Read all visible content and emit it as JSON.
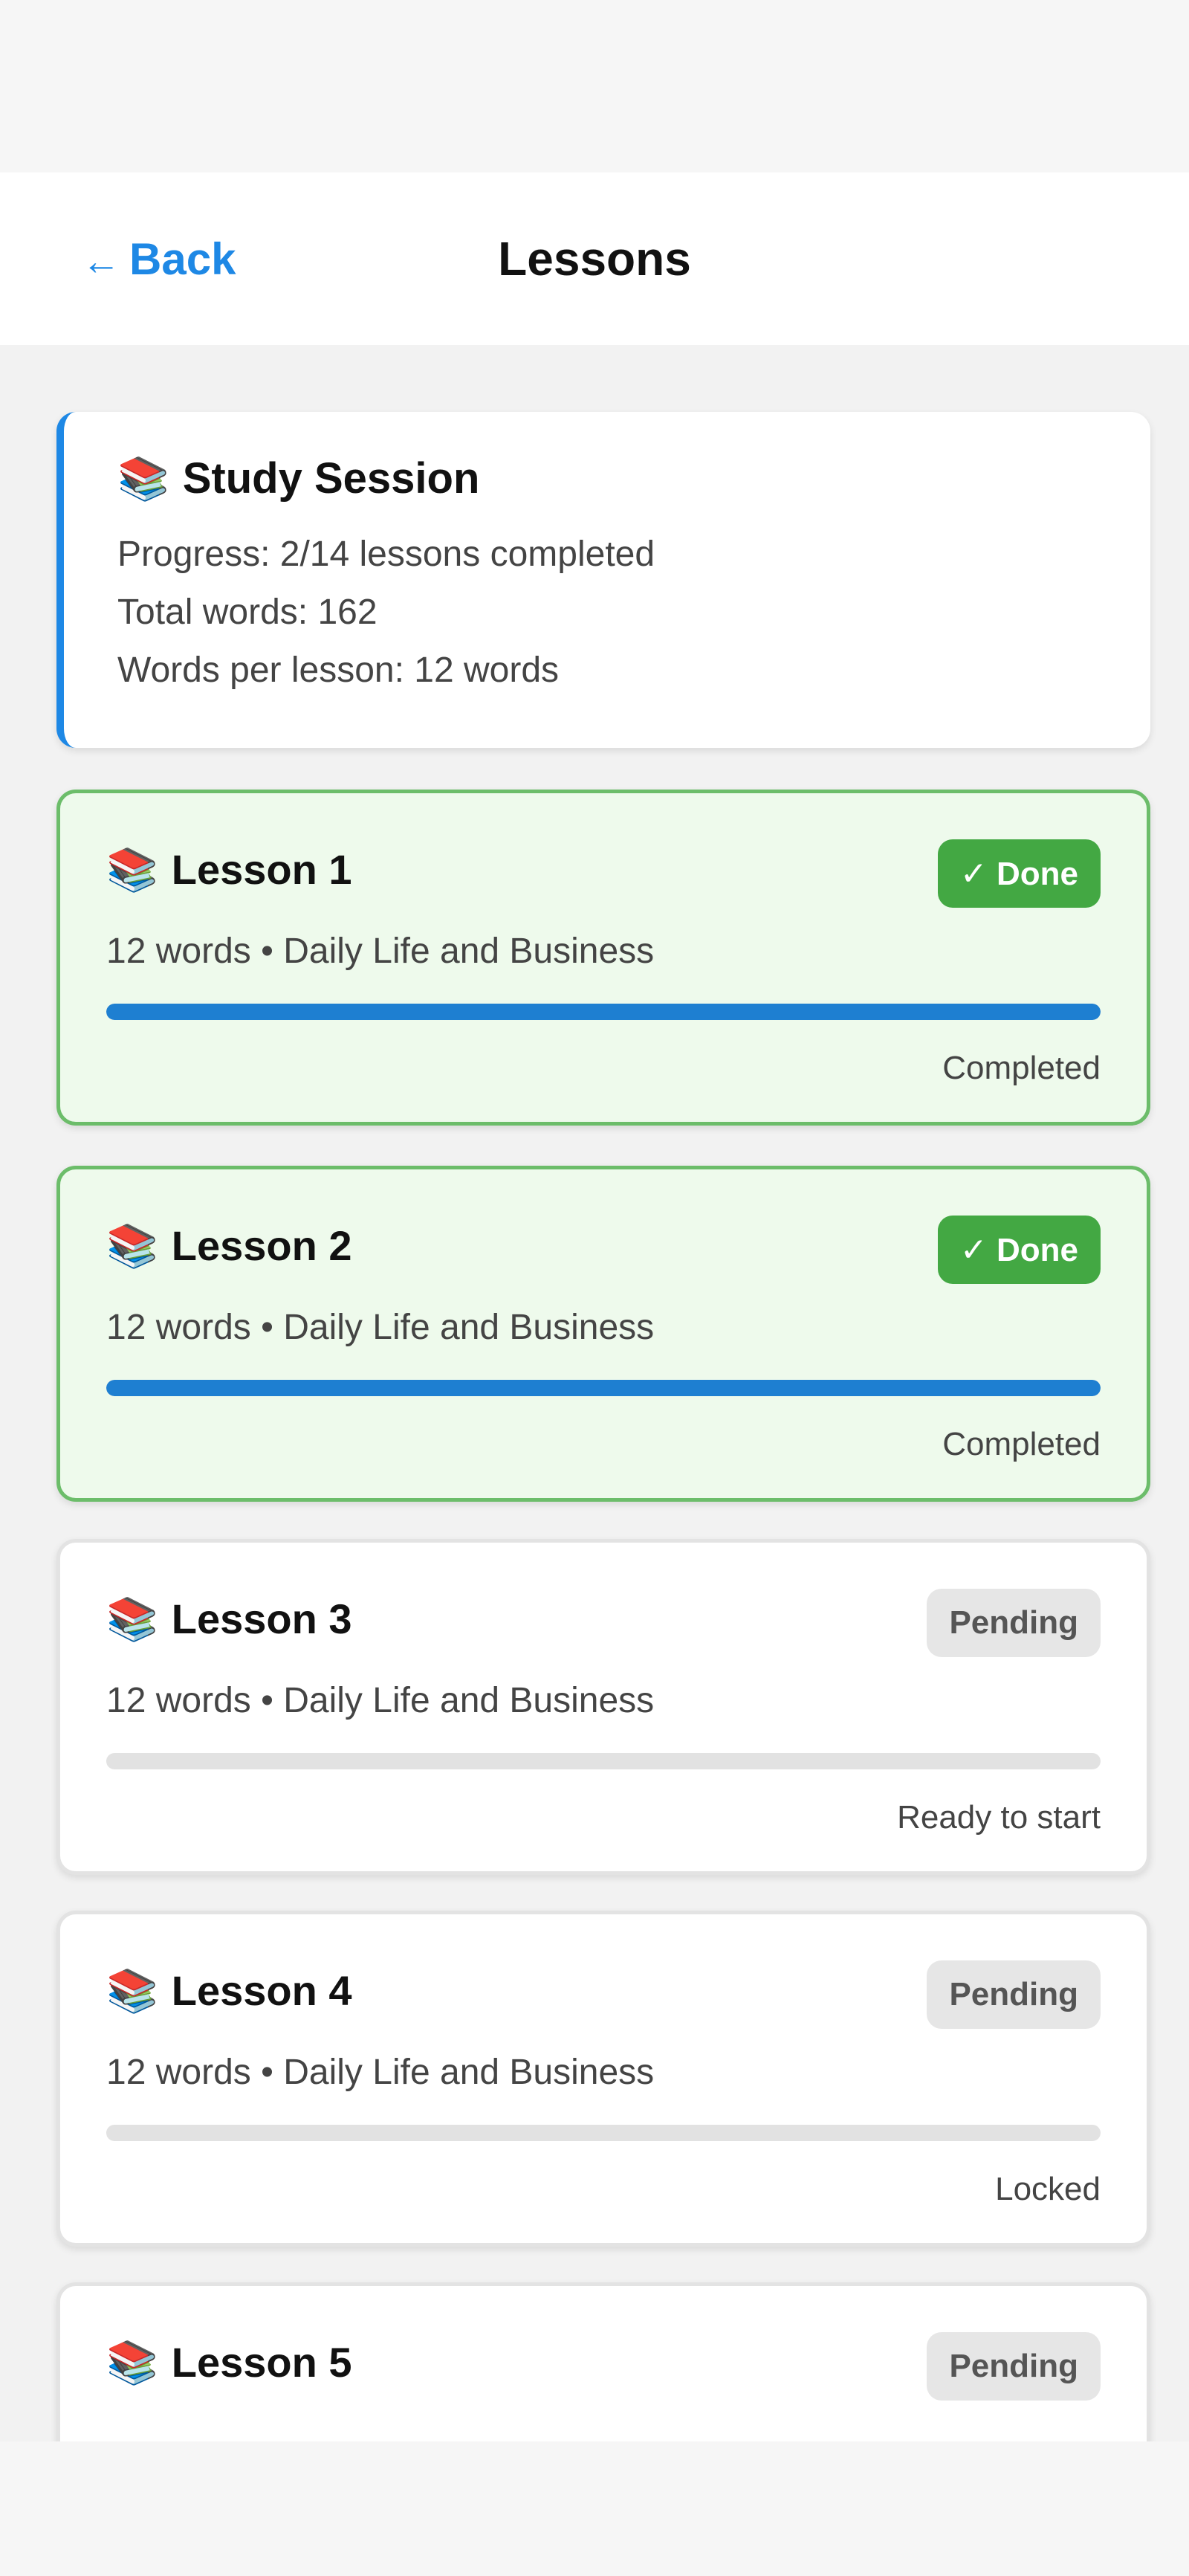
{
  "header": {
    "back_label": "Back",
    "back_arrow": "←",
    "title": "Lessons"
  },
  "summary": {
    "icon": "books-icon",
    "title": "Study Session",
    "progress": "Progress: 2/14 lessons completed",
    "total_words": "Total words: 162",
    "words_per_lesson": "Words per lesson: 12 words"
  },
  "lessons": [
    {
      "title": "Lesson 1",
      "meta": "12 words • Daily Life and Business",
      "badge": "✓ Done",
      "state": "done",
      "progress": 1.0,
      "status": "Completed"
    },
    {
      "title": "Lesson 2",
      "meta": "12 words • Daily Life and Business",
      "badge": "✓ Done",
      "state": "done",
      "progress": 1.0,
      "status": "Completed"
    },
    {
      "title": "Lesson 3",
      "meta": "12 words • Daily Life and Business",
      "badge": "Pending",
      "state": "pending",
      "progress": 0.0,
      "status": "Ready to start"
    },
    {
      "title": "Lesson 4",
      "meta": "12 words • Daily Life and Business",
      "badge": "Pending",
      "state": "pending",
      "progress": 0.0,
      "status": "Locked"
    },
    {
      "title": "Lesson 5",
      "meta": "",
      "badge": "Pending",
      "state": "pending",
      "progress": 0.0,
      "status": ""
    }
  ],
  "colors": {
    "accent": "#1e88e5",
    "done_bg": "#eefaec",
    "done_border": "#6cbd6a",
    "done_badge": "#43a843",
    "pending_badge": "#e6e6e6",
    "progress_fill": "#1e7fd1"
  }
}
